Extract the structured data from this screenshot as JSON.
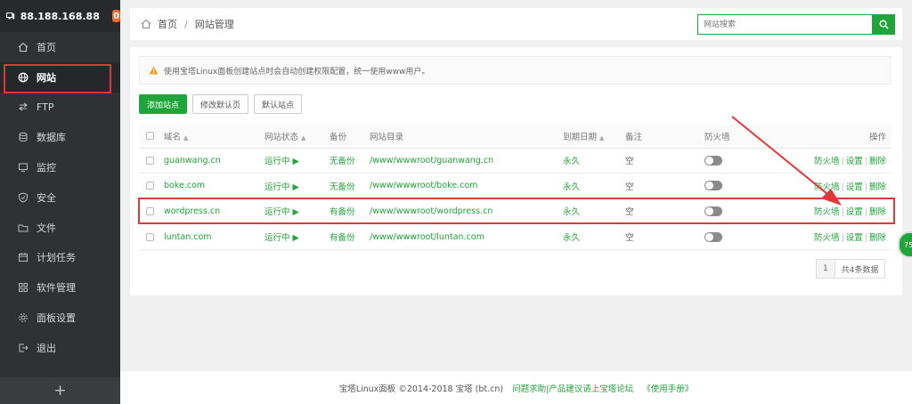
{
  "sidebar": {
    "ip": "88.188.168.88",
    "badge": "0",
    "items": [
      {
        "label": "首页",
        "icon": "home-icon"
      },
      {
        "label": "网站",
        "icon": "globe-icon"
      },
      {
        "label": "FTP",
        "icon": "ftp-icon"
      },
      {
        "label": "数据库",
        "icon": "database-icon"
      },
      {
        "label": "监控",
        "icon": "monitor-icon"
      },
      {
        "label": "安全",
        "icon": "shield-icon"
      },
      {
        "label": "文件",
        "icon": "folder-icon"
      },
      {
        "label": "计划任务",
        "icon": "calendar-icon"
      },
      {
        "label": "软件管理",
        "icon": "grid-icon"
      },
      {
        "label": "面板设置",
        "icon": "gear-icon"
      },
      {
        "label": "退出",
        "icon": "logout-icon"
      }
    ],
    "plus": "+"
  },
  "breadcrumb": {
    "home": "首页",
    "sep": "/",
    "current": "网站管理"
  },
  "search": {
    "placeholder": "网站搜索"
  },
  "notice": "使用宝塔Linux面板创建站点时会自动创建权限配置，统一使用www用户。",
  "buttons": {
    "add": "添加站点",
    "modify_default": "修改默认页",
    "default_site": "默认站点"
  },
  "table": {
    "headers": {
      "domain": "域名",
      "status": "网站状态",
      "backup": "备份",
      "dir": "网站目录",
      "expire": "到期日期",
      "note": "备注",
      "firewall": "防火墙",
      "ops": "操作"
    },
    "rows": [
      {
        "domain": "guanwang.cn",
        "status": "运行中 ▶",
        "backup": "无备份",
        "dir": "/www/wwwroot/guanwang.cn",
        "expire": "永久",
        "note": "空"
      },
      {
        "domain": "boke.com",
        "status": "运行中 ▶",
        "backup": "无备份",
        "dir": "/www/wwwroot/boke.com",
        "expire": "永久",
        "note": "空"
      },
      {
        "domain": "wordpress.cn",
        "status": "运行中 ▶",
        "backup": "有备份",
        "dir": "/www/wwwroot/wordpress.cn",
        "expire": "永久",
        "note": "空"
      },
      {
        "domain": "luntan.com",
        "status": "运行中 ▶",
        "backup": "有备份",
        "dir": "/www/wwwroot/luntan.com",
        "expire": "永久",
        "note": "空"
      }
    ],
    "ops": {
      "firewall": "防火墙",
      "settings": "设置",
      "delete": "删除",
      "sep": "|"
    }
  },
  "pager": {
    "page": "1",
    "total": "共4条数据"
  },
  "footer": {
    "copyright": "宝塔Linux面板 ©2014-2018 宝塔 (bt.cn)",
    "forum": "问题求助|产品建议请上宝塔论坛",
    "manual": "《使用手册》"
  },
  "float_badge": "75",
  "colors": {
    "accent": "#20a53a",
    "highlight": "#e0373a",
    "sidebar": "#2f3135"
  }
}
